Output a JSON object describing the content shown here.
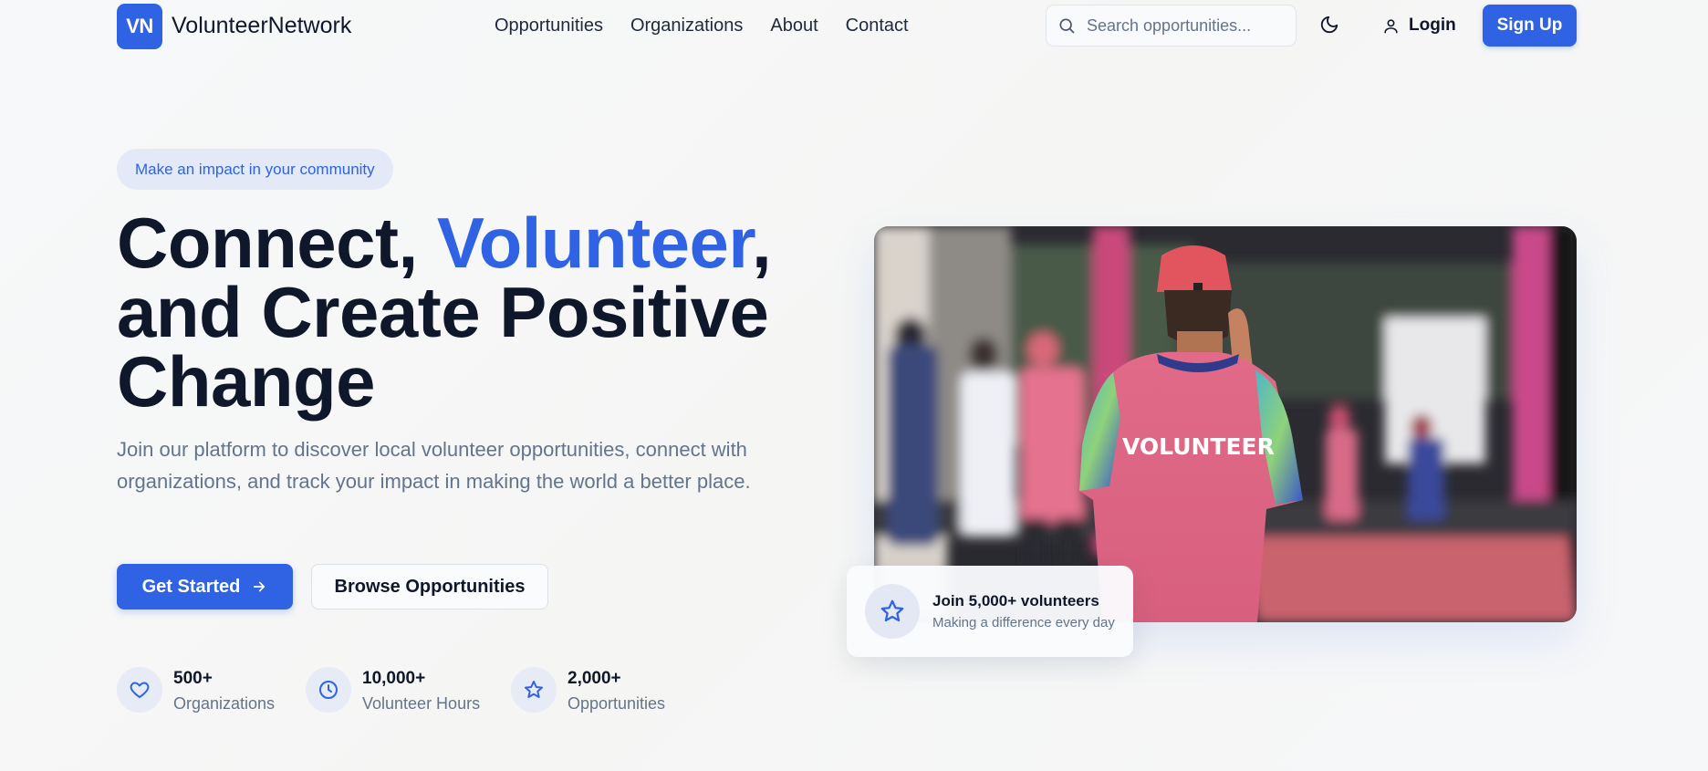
{
  "brand": {
    "badge": "VN",
    "name": "VolunteerNetwork",
    "accent": "#2f63e3"
  },
  "nav": {
    "items": [
      {
        "label": "Opportunities"
      },
      {
        "label": "Organizations"
      },
      {
        "label": "About"
      },
      {
        "label": "Contact"
      }
    ]
  },
  "search": {
    "placeholder": "Search opportunities...",
    "icon": "search-icon"
  },
  "header": {
    "theme_icon": "moon-icon",
    "login_label": "Login",
    "login_icon": "user-icon",
    "signup_label": "Sign Up"
  },
  "hero": {
    "pill": "Make an impact in your community",
    "headline_part1": "Connect, ",
    "headline_accent": "Volunteer",
    "headline_part2": ",",
    "headline_line2": "and Create Positive",
    "headline_line3": "Change",
    "lead": "Join our platform to discover local volunteer opportunities, connect with organizations, and track your impact in making the world a better place.",
    "primary_button": "Get Started",
    "primary_icon": "arrow-right-icon",
    "secondary_button": "Browse Opportunities"
  },
  "stats": [
    {
      "icon": "heart-icon",
      "value": "500+",
      "label": "Organizations"
    },
    {
      "icon": "clock-icon",
      "value": "10,000+",
      "label": "Volunteer Hours"
    },
    {
      "icon": "star-icon",
      "value": "2,000+",
      "label": "Opportunities"
    }
  ],
  "image": {
    "shirt_text": "VOLUNTEER"
  },
  "float_card": {
    "icon": "star-icon",
    "title": "Join 5,000+ volunteers",
    "subtitle": "Making a difference every day"
  }
}
